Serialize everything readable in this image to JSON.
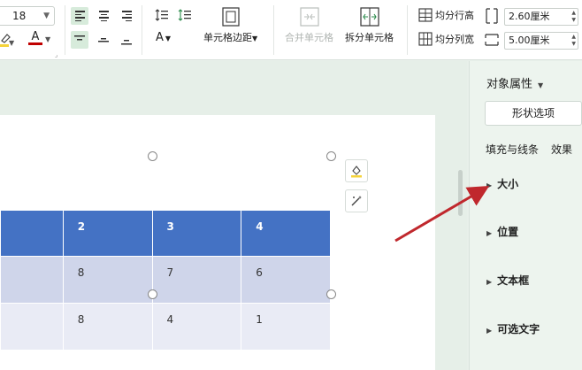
{
  "ribbon": {
    "font_size": "18",
    "cell_margin_label": "单元格边距",
    "merge_cells_label": "合并单元格",
    "split_cells_label": "拆分单元格",
    "distribute_rows_label": "均分行高",
    "distribute_cols_label": "均分列宽",
    "row_height_value": "2.60厘米",
    "col_width_value": "5.00厘米",
    "font_color_letter": "A",
    "text_dir_letter": "A"
  },
  "table": {
    "header": [
      "",
      "2",
      "3",
      "4"
    ],
    "rows": [
      [
        "",
        "8",
        "7",
        "6"
      ],
      [
        "",
        "8",
        "4",
        "1"
      ]
    ]
  },
  "panel": {
    "title": "对象属性",
    "shape_options_tab": "形状选项",
    "subtabs": [
      "填充与线条",
      "效果"
    ],
    "sections": [
      "大小",
      "位置",
      "文本框",
      "可选文字"
    ]
  },
  "colors": {
    "header_fill": "#4472c4",
    "row1_fill": "#cfd5ea",
    "row2_fill": "#e9ebf5",
    "annotation_arrow": "#c0282d",
    "font_color_bar": "#c00000",
    "highlight_bar": "#f5d33a"
  }
}
